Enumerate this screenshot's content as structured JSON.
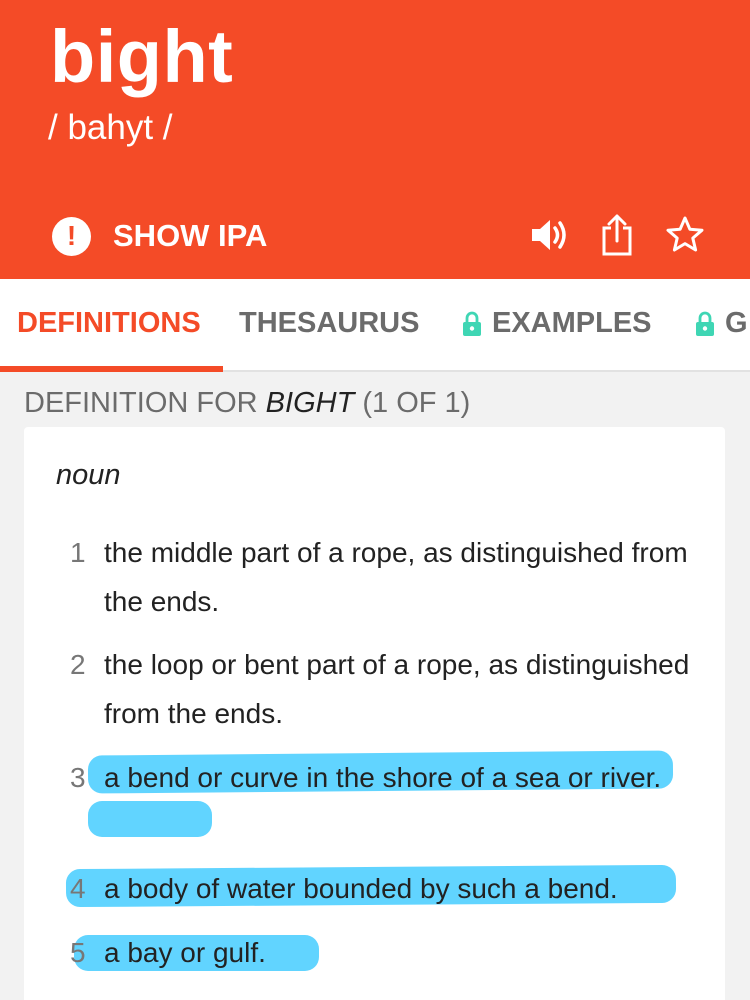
{
  "header": {
    "word": "bight",
    "pronunciation": "/ bahyt  /",
    "show_ipa_label": "SHOW IPA",
    "icons": [
      "alert-icon",
      "speaker-icon",
      "share-icon",
      "star-icon"
    ],
    "background_color": "#f44b27"
  },
  "tabs": [
    {
      "label": "DEFINITIONS",
      "active": true,
      "locked": false
    },
    {
      "label": "THESAURUS",
      "active": false,
      "locked": false
    },
    {
      "label": "EXAMPLES",
      "active": false,
      "locked": true
    },
    {
      "label": "G",
      "active": false,
      "locked": true
    }
  ],
  "definition_header": {
    "prefix": "DEFINITION FOR ",
    "word": "BIGHT",
    "suffix": " (1 OF 1)"
  },
  "part_of_speech": "noun",
  "definitions": [
    {
      "num": "1",
      "text": "the middle part of a rope, as distinguished from the ends."
    },
    {
      "num": "2",
      "text": "the loop or bent part of a rope, as distinguished from the ends."
    },
    {
      "num": "3",
      "text": "a bend or curve in the shore of a sea or river."
    },
    {
      "num": "4",
      "text": "a body of water bounded by such a bend."
    },
    {
      "num": "5",
      "text": "a bay or gulf."
    }
  ],
  "colors": {
    "accent": "#f44b27",
    "lock": "#3fd6b4",
    "highlight": "#24c4ff"
  }
}
